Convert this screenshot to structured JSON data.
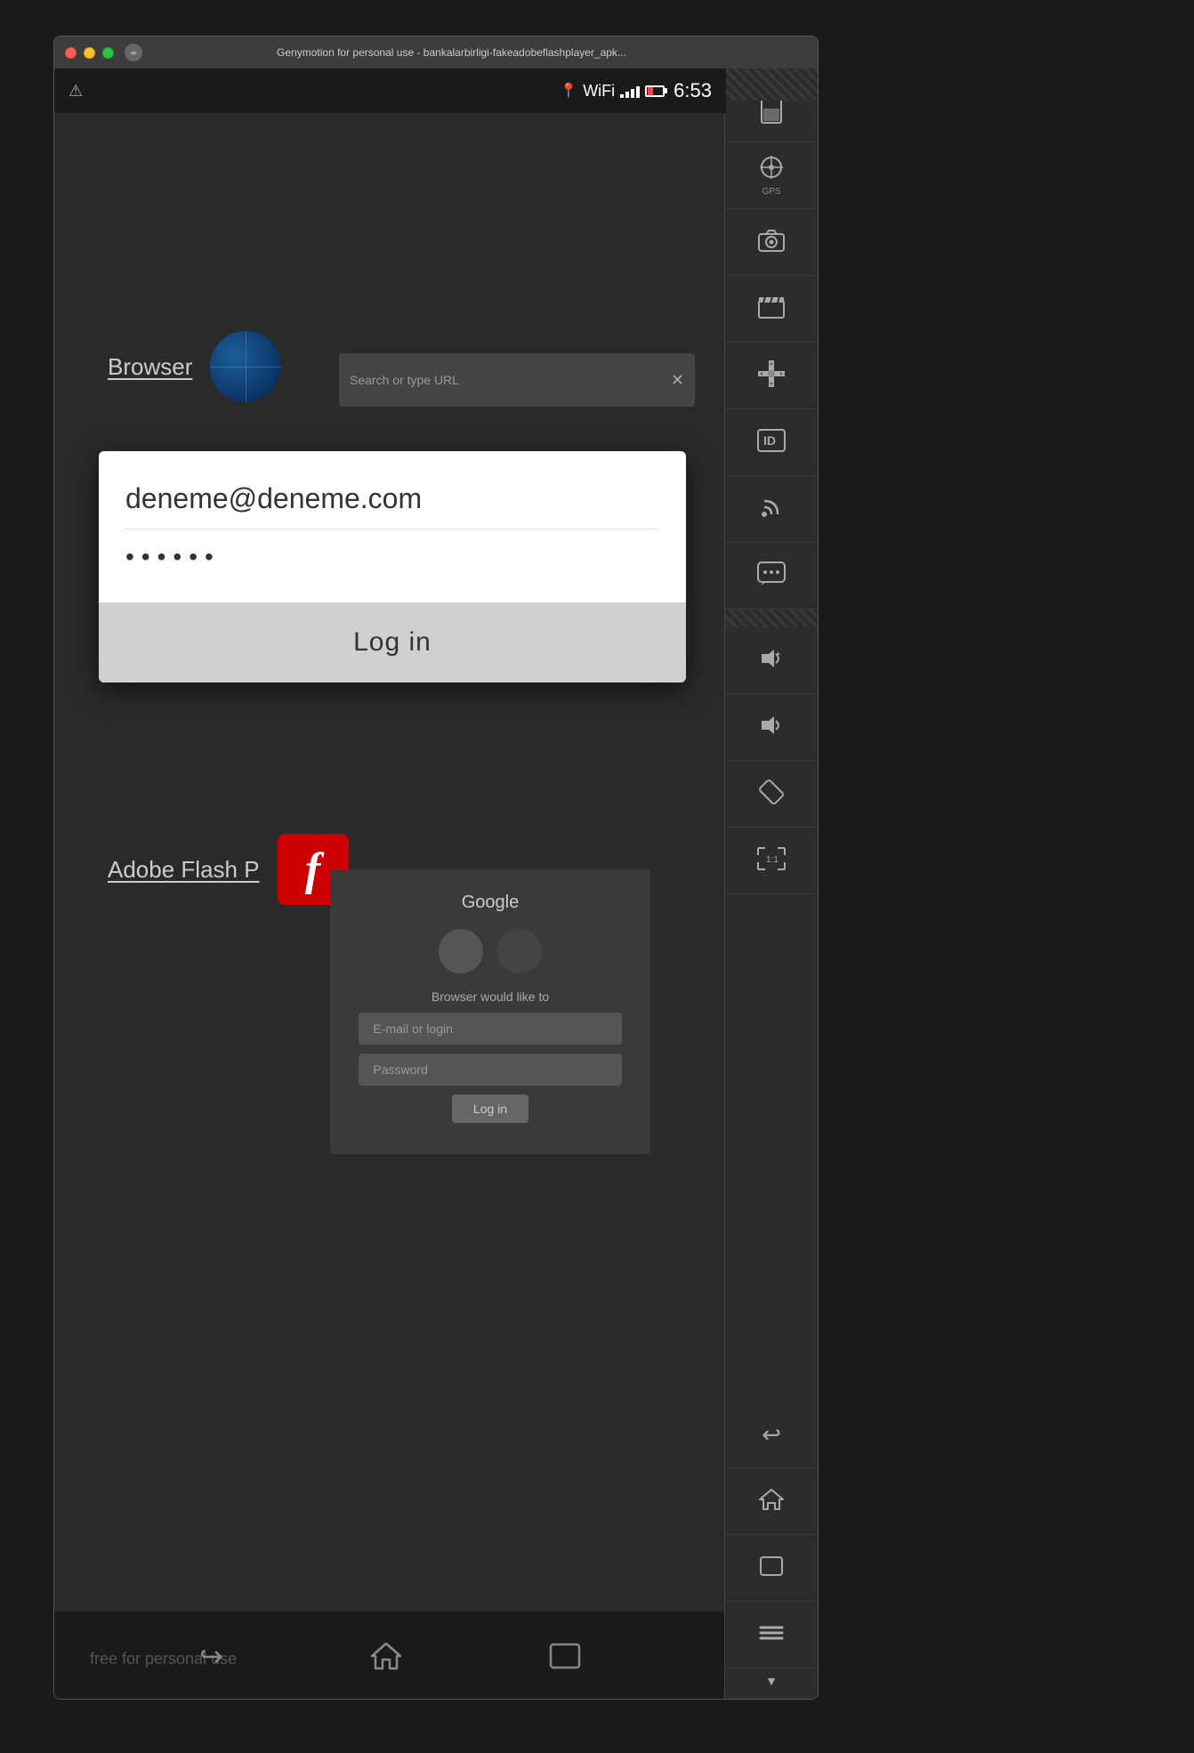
{
  "window": {
    "title": "Genymotion for personal use - bankalarbirligi-fakeadobeflashplayer_apk..."
  },
  "status_bar": {
    "time": "6:53",
    "warning_char": "⚠"
  },
  "browser_section": {
    "label": "Browser",
    "url_placeholder": "Search or type URL"
  },
  "login_dialog": {
    "email": "deneme@deneme.com",
    "password_dots": "••••••",
    "login_btn": "Log in"
  },
  "adobe_section": {
    "label": "Adobe Flash P",
    "flash_letter": "f"
  },
  "background_browser": {
    "google_label": "Google",
    "notice": "Browser would like to",
    "email_field": "E-mail or login",
    "password_field": "Password",
    "login_btn": "Log in"
  },
  "nav_bar": {
    "free_text": "free for personal use"
  },
  "sidebar": {
    "battery_label": "",
    "gps_label": "GPS",
    "camera_label": "",
    "clapboard_label": "",
    "dpad_label": "",
    "id_label": "",
    "rss_label": "",
    "chat_label": "",
    "vol_up_label": "",
    "vol_down_label": "",
    "rotate_label": "",
    "scale_label": ""
  },
  "bottom_controls": {
    "back_label": "back",
    "home_label": "home",
    "recents_label": "recents",
    "sidebar_back_label": "",
    "sidebar_home_label": "",
    "sidebar_recents_label": "",
    "sidebar_menu_label": ""
  }
}
